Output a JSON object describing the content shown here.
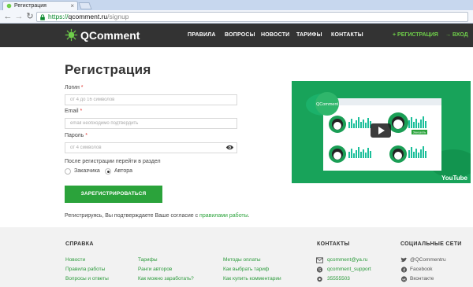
{
  "browser": {
    "tab_title": "Регистрация",
    "url_scheme": "https://",
    "url_host": "qcomment.ru",
    "url_path": "/signup"
  },
  "header": {
    "logo_text": "QComment",
    "nav": [
      "ПРАВИЛА",
      "ВОПРОСЫ",
      "НОВОСТИ",
      "ТАРИФЫ",
      "КОНТАКТЫ"
    ],
    "register_link": "+ РЕГИСТРАЦИЯ",
    "login_link": "→ ВХОД"
  },
  "form": {
    "title": "Регистрация",
    "login_label": "Логин",
    "login_placeholder": "от 4 до 16 символов",
    "email_label": "Email",
    "email_placeholder": "email необходимо подтвердить",
    "password_label": "Пароль",
    "password_placeholder": "от 4 символов",
    "required_mark": "*",
    "after_label": "После регистрации перейти в раздел",
    "radio_options": [
      {
        "label": "Заказчика",
        "checked": false
      },
      {
        "label": "Автора",
        "checked": true
      }
    ],
    "submit_label": "ЗАРЕГИСТРИРОВАТЬСЯ",
    "consent_prefix": "Регистрируясь, Вы подтверждаете Ваше согласие с",
    "consent_link": "правилами работы",
    "consent_suffix": "."
  },
  "video": {
    "brand": "QComment",
    "button_text": "Заказать",
    "youtube": "YouTube"
  },
  "footer": {
    "help_heading": "СПРАВКА",
    "col1": [
      "Новости",
      "Правила работы",
      "Вопросы и ответы"
    ],
    "col2": [
      "Тарифы",
      "Ранги авторов",
      "Как можно заработать?"
    ],
    "col3": [
      "Методы оплаты",
      "Как выбрать тариф",
      "Как купить комментарии"
    ],
    "contacts_heading": "КОНТАКТЫ",
    "contacts": [
      "qcomment@ya.ru",
      "qcomment_support",
      "35555503"
    ],
    "social_heading": "СОЦИАЛЬНЫЕ СЕТИ",
    "social": [
      "@QCommentru",
      "Facebook",
      "Вконтакте"
    ]
  },
  "colors": {
    "accent": "#2ba33b",
    "header_bg": "#333333",
    "video_bg": "#18a35a"
  }
}
